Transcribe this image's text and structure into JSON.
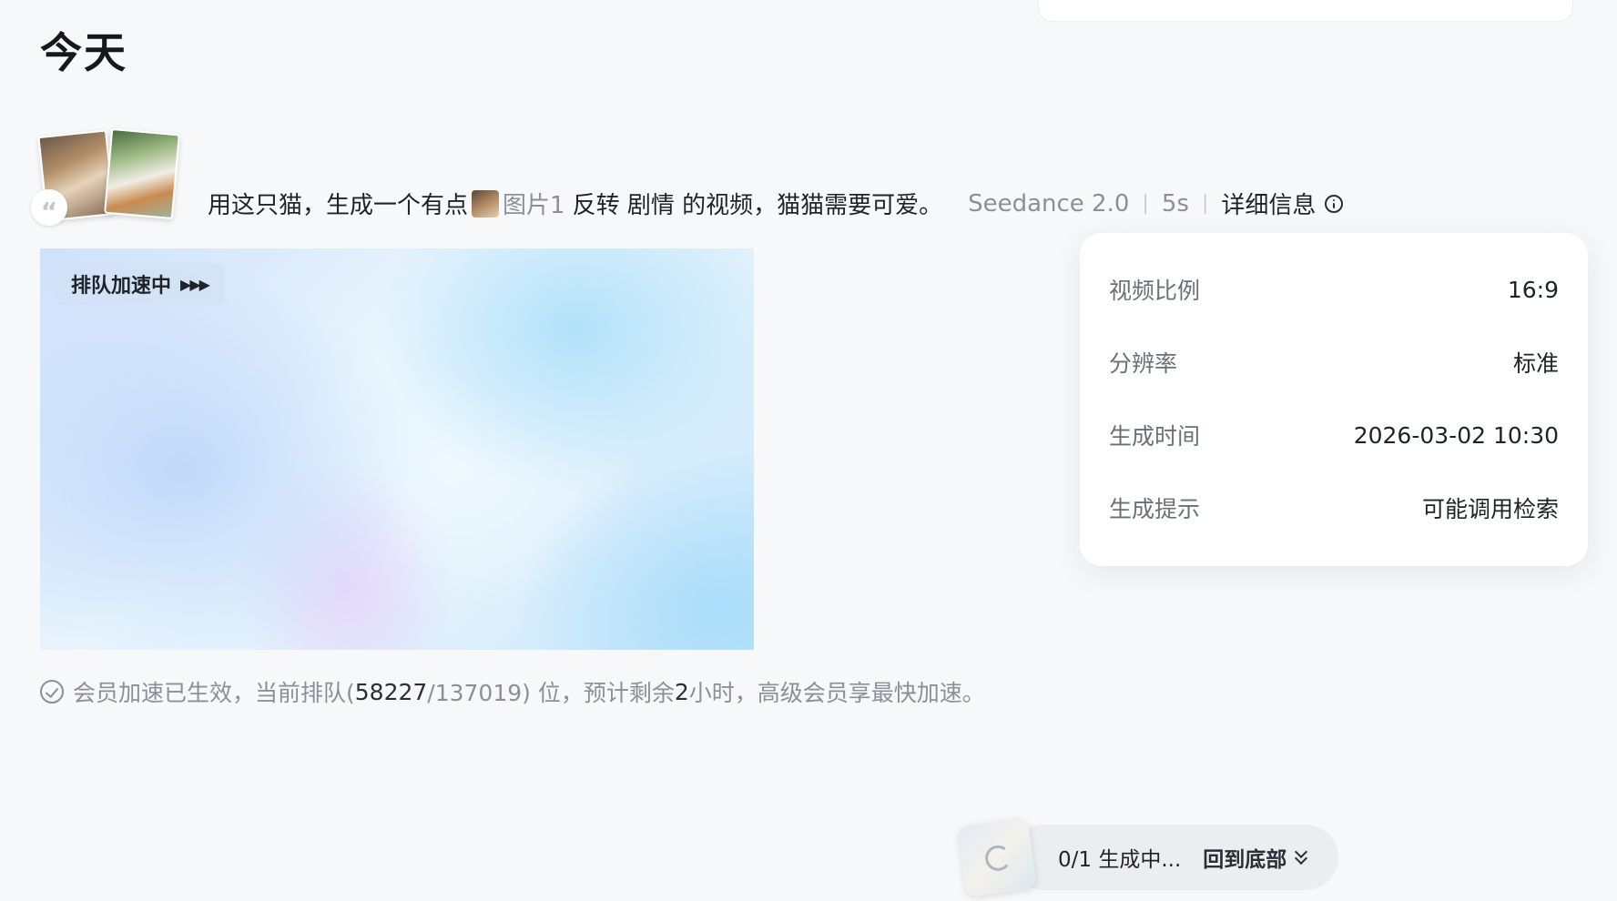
{
  "section": {
    "heading": "今天"
  },
  "prompt": {
    "text_before": "用这只猫，生成一个有点",
    "ref_label": "图片1",
    "text_after": "反转 剧情 的视频，猫猫需要可爱。",
    "model": "Seedance 2.0",
    "duration": "5s",
    "detail_label": "详细信息",
    "quote_glyph": "“",
    "separator": "|"
  },
  "video": {
    "queue_badge": "排队加速中",
    "badge_arrows": "▶▶▶"
  },
  "status": {
    "prefix": "会员加速已生效，当前排队(",
    "position": "58227",
    "total": "/137019) 位，预计剩余 ",
    "hours": "2",
    "suffix": " 小时，高级会员享最快加速。"
  },
  "details": {
    "rows": [
      {
        "label": "视频比例",
        "value": "16:9"
      },
      {
        "label": "分辨率",
        "value": "标准"
      },
      {
        "label": "生成时间",
        "value": "2026-03-02 10:30"
      },
      {
        "label": "生成提示",
        "value": "可能调用检索"
      }
    ]
  },
  "bottom_bar": {
    "progress": "0/1 生成中...",
    "back_to_bottom": "回到底部"
  },
  "icons": {
    "quote": "quote-icon",
    "info": "info-icon",
    "check": "check-circle-icon",
    "chevron": "double-chevron-down-icon",
    "loader": "loading-icon"
  }
}
